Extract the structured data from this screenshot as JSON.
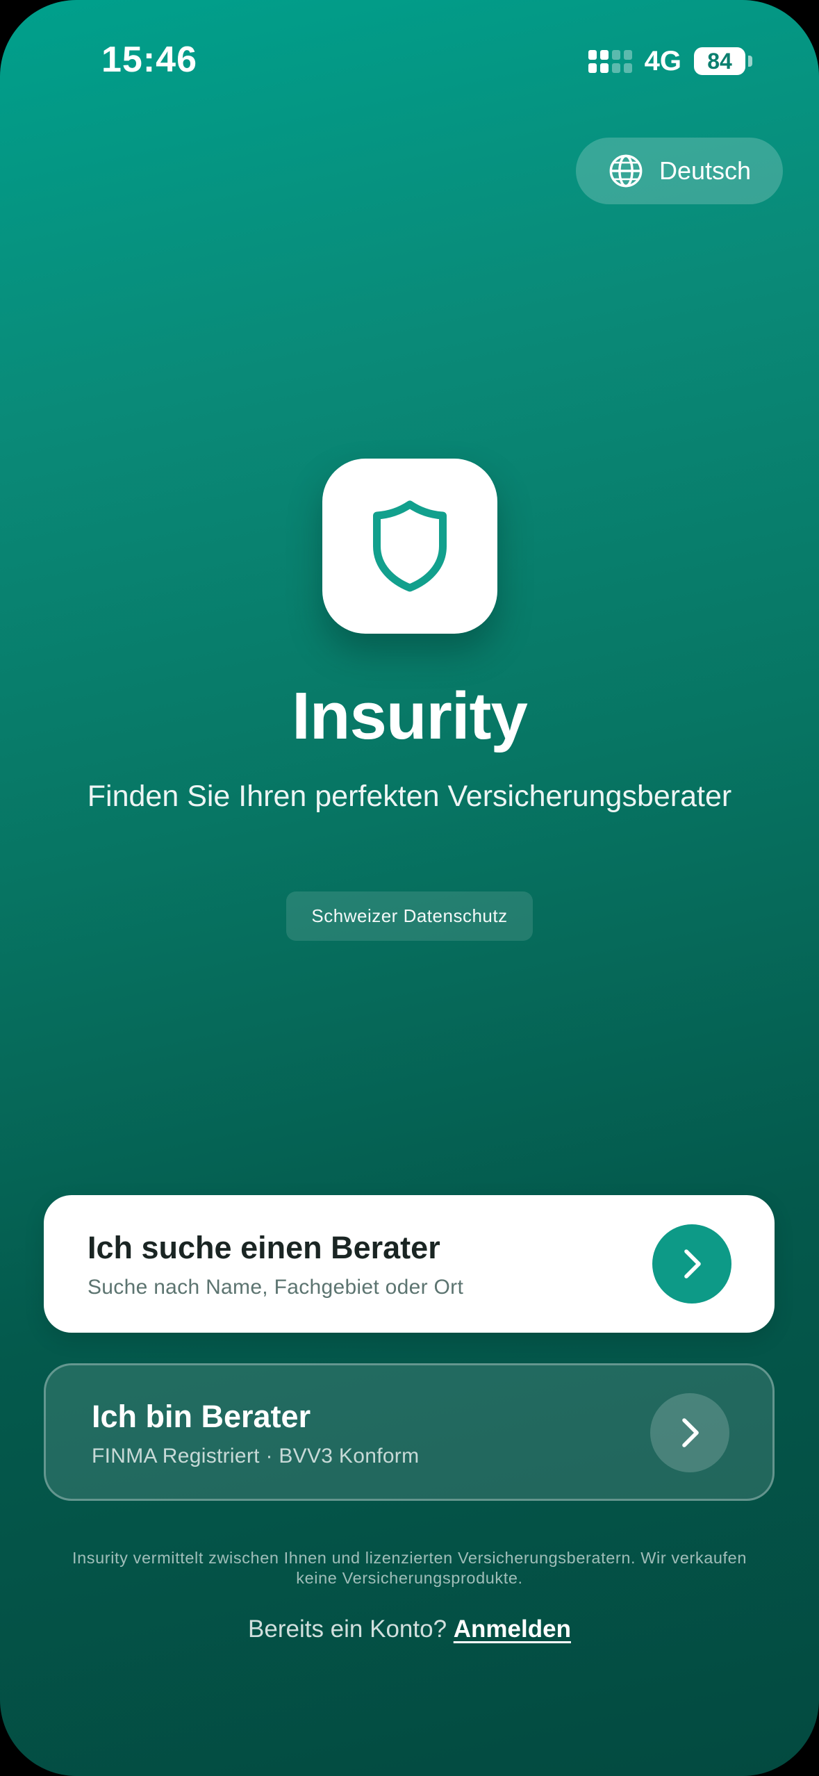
{
  "status_bar": {
    "time": "15:46",
    "network": "4G",
    "battery": "84"
  },
  "language": {
    "label": "Deutsch",
    "icon": "globe-icon"
  },
  "brand": {
    "logo_icon": "shield-icon",
    "name": "Insurity",
    "tagline": "Finden Sie Ihren perfekten Versicherungsberater",
    "badge": "Schweizer Datenschutz"
  },
  "options": {
    "client": {
      "title": "Ich suche einen Berater",
      "subtitle": "Suche nach Name, Fachgebiet oder Ort",
      "icon": "chevron-right-icon"
    },
    "advisor": {
      "title": "Ich bin Berater",
      "subtitle": "FINMA Registriert · BVV3 Konform",
      "icon": "chevron-right-icon"
    }
  },
  "footer": {
    "disclaimer": "Insurity vermittelt zwischen Ihnen und lizenzierten Versicherungsberatern. Wir verkaufen keine Versicherungsprodukte.",
    "login_prompt": "Bereits ein Konto?",
    "login_link": "Anmelden"
  },
  "colors": {
    "accent": "#0d9a87",
    "gradient_top": "#00a08c",
    "gradient_bottom": "#034a40"
  }
}
